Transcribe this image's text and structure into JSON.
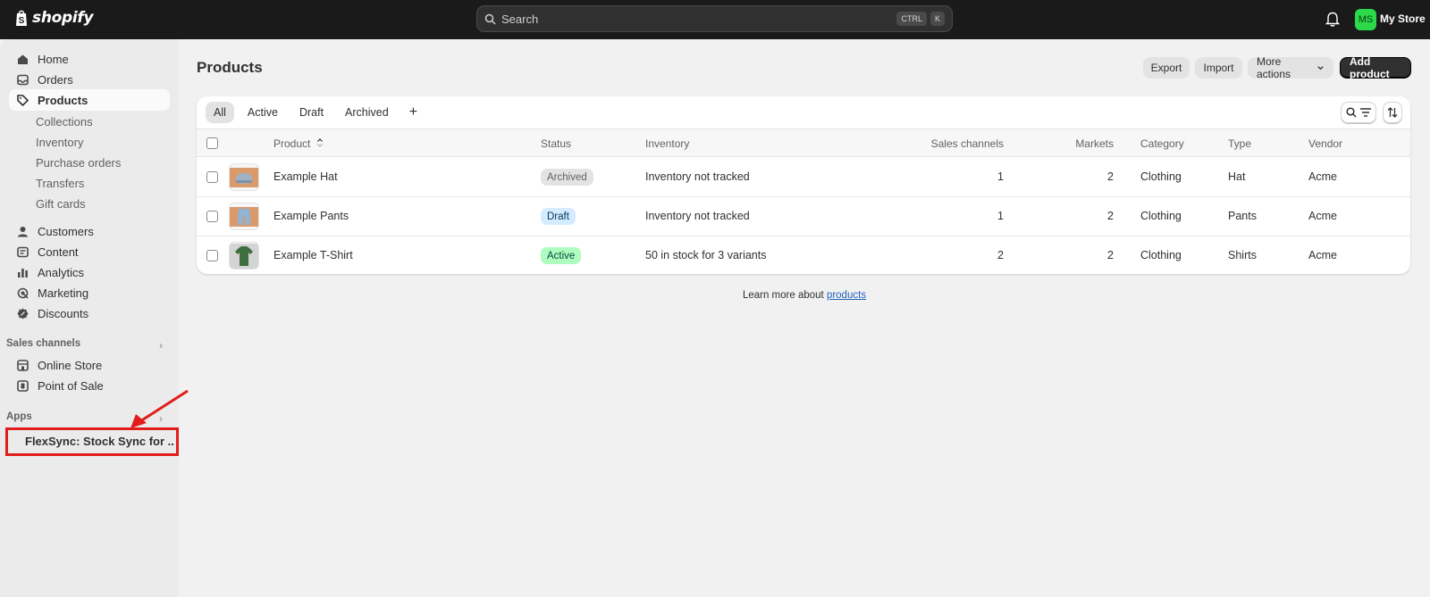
{
  "topbar": {
    "logo": "shopify",
    "search_placeholder": "Search",
    "shortcut_keys": [
      "CTRL",
      "K"
    ],
    "avatar_initials": "MS",
    "store_name": "My Store"
  },
  "sidebar": {
    "nav": [
      {
        "label": "Home",
        "icon": "home-icon"
      },
      {
        "label": "Orders",
        "icon": "inbox-icon"
      },
      {
        "label": "Products",
        "icon": "tag-icon",
        "active": true
      }
    ],
    "product_subitems": [
      "Collections",
      "Inventory",
      "Purchase orders",
      "Transfers",
      "Gift cards"
    ],
    "nav2": [
      {
        "label": "Customers",
        "icon": "person-icon"
      },
      {
        "label": "Content",
        "icon": "content-icon"
      },
      {
        "label": "Analytics",
        "icon": "bar-chart-icon"
      },
      {
        "label": "Marketing",
        "icon": "target-icon"
      },
      {
        "label": "Discounts",
        "icon": "discount-icon"
      }
    ],
    "sales_channels_label": "Sales channels",
    "sales_channels": [
      {
        "label": "Online Store",
        "icon": "store-icon"
      },
      {
        "label": "Point of Sale",
        "icon": "pos-icon"
      }
    ],
    "apps_label": "Apps",
    "apps": [
      {
        "label": "FlexSync: Stock Sync for ...",
        "icon": "app-icon"
      }
    ]
  },
  "main": {
    "title": "Products",
    "actions": {
      "export": "Export",
      "import": "Import",
      "more": "More actions",
      "add": "Add product"
    },
    "tabs": [
      "All",
      "Active",
      "Draft",
      "Archived"
    ],
    "tab_add": "+",
    "columns": {
      "product": "Product",
      "status": "Status",
      "inventory": "Inventory",
      "sales_channels": "Sales channels",
      "markets": "Markets",
      "category": "Category",
      "type": "Type",
      "vendor": "Vendor"
    },
    "rows": [
      {
        "name": "Example Hat",
        "status": "Archived",
        "inventory": "Inventory not tracked",
        "sales_channels": "1",
        "markets": "2",
        "category": "Clothing",
        "type": "Hat",
        "vendor": "Acme"
      },
      {
        "name": "Example Pants",
        "status": "Draft",
        "inventory": "Inventory not tracked",
        "sales_channels": "1",
        "markets": "2",
        "category": "Clothing",
        "type": "Pants",
        "vendor": "Acme"
      },
      {
        "name": "Example T-Shirt",
        "status": "Active",
        "inventory": "50 in stock for 3 variants",
        "sales_channels": "2",
        "markets": "2",
        "category": "Clothing",
        "type": "Shirts",
        "vendor": "Acme"
      }
    ],
    "learn_more_prefix": "Learn more about ",
    "learn_more_link": "products"
  },
  "colors": {
    "topbar": "#1a1a1a",
    "status_archived": "#e3e3e3",
    "status_draft": "#d5ebff",
    "status_active": "#affebf",
    "highlight": "#e11d1d"
  }
}
